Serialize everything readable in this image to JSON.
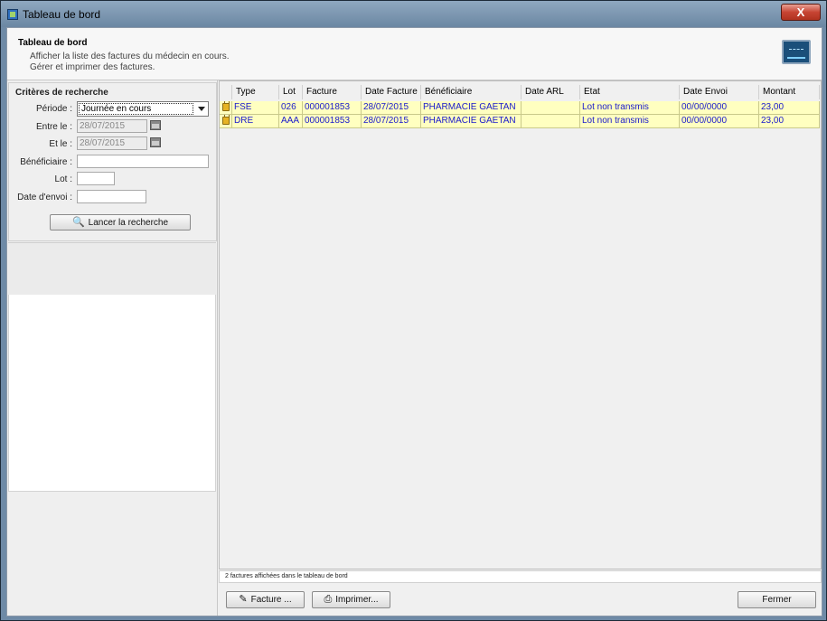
{
  "window": {
    "title": "Tableau de bord",
    "close_label": "X"
  },
  "header": {
    "title": "Tableau de bord",
    "line1": "Afficher la liste des factures du médecin en cours.",
    "line2": "Gérer et imprimer des factures."
  },
  "criteria": {
    "title": "Critères de recherche",
    "periode_label": "Période :",
    "periode_value": "Journée en cours",
    "entre_label": "Entre le :",
    "entre_value": "28/07/2015",
    "etle_label": "Et le :",
    "etle_value": "28/07/2015",
    "beneficiaire_label": "Bénéficiaire :",
    "beneficiaire_value": "",
    "lot_label": "Lot :",
    "lot_value": "",
    "dateenvoi_label": "Date d'envoi :",
    "dateenvoi_value": "",
    "search_button": "Lancer la recherche"
  },
  "table": {
    "columns": [
      "Type",
      "Lot",
      "Facture",
      "Date Facture",
      "Bénéficiaire",
      "Date ARL",
      "Etat",
      "Date Envoi",
      "Montant"
    ],
    "rows": [
      [
        "FSE",
        "026",
        "000001853",
        "28/07/2015",
        "PHARMACIE GAETAN",
        "",
        "Lot non transmis",
        "00/00/0000",
        "23,00"
      ],
      [
        "DRE",
        "AAA",
        "000001853",
        "28/07/2015",
        "PHARMACIE GAETAN",
        "",
        "Lot non transmis",
        "00/00/0000",
        "23,00"
      ]
    ]
  },
  "status": "2 factures affichées dans le tableau de bord",
  "footer": {
    "facture_button": "Facture ...",
    "imprimer_button": "Imprimer...",
    "fermer_button": "Fermer"
  },
  "icons": {
    "title": "app-icon",
    "header": "dashboard-chart-icon",
    "search": "magnifier-icon",
    "lock": "lock-icon",
    "pencil": "pencil-icon",
    "printer": "printer-icon"
  }
}
